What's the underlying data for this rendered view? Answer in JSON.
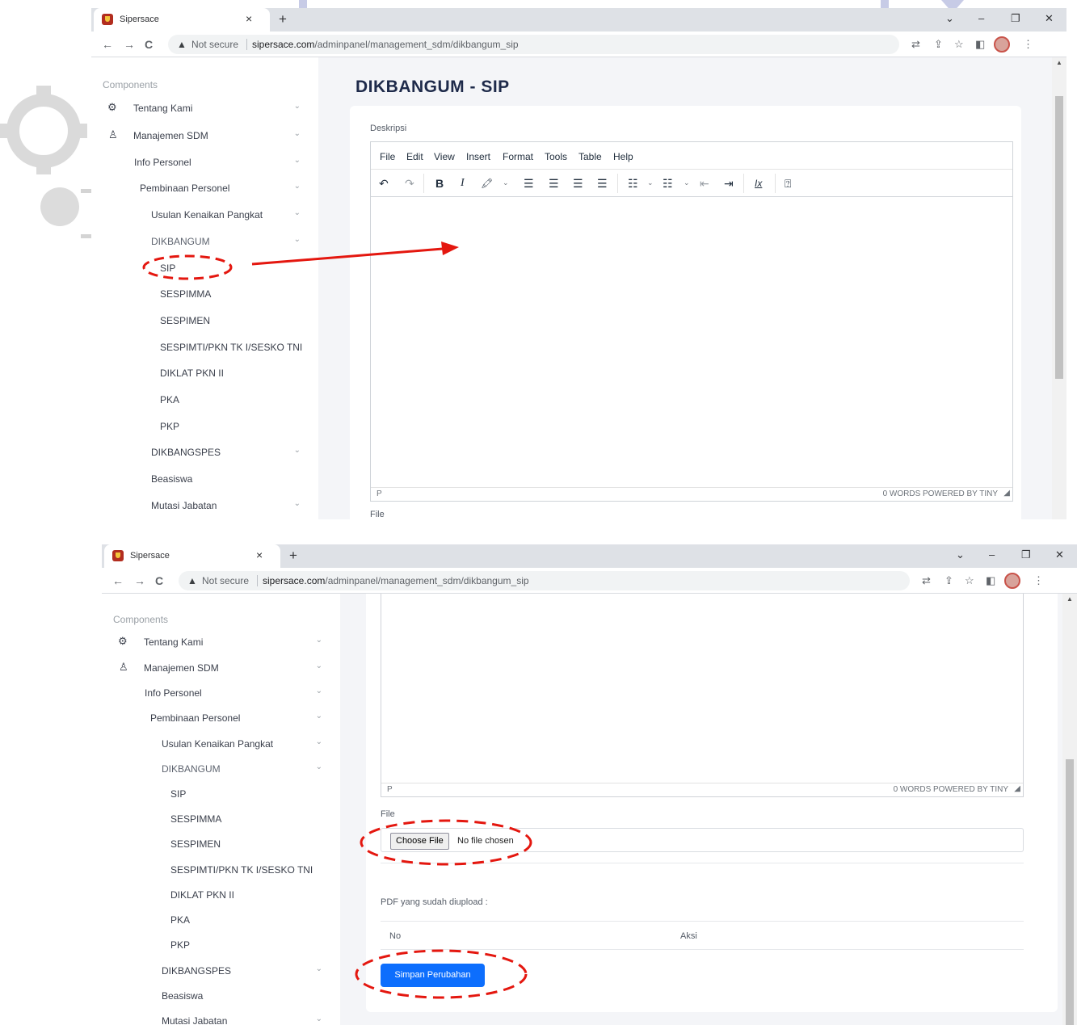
{
  "browser": {
    "tab_title": "Sipersace",
    "tab_close": "×",
    "new_tab": "+",
    "win_min": "–",
    "win_restore": "❐",
    "win_close": "✕",
    "win_menu": "⌄",
    "nav_back": "←",
    "nav_forward": "→",
    "nav_reload": "C",
    "warning_icon": "▲",
    "not_secure": "Not secure",
    "url_host": "sipersace.com",
    "url_path": "/adminpanel/management_sdm/dikbangum_sip",
    "icons": {
      "translate": "⇄",
      "share": "⇪",
      "star": "☆",
      "sidepanel": "◧",
      "menu": "⋮"
    }
  },
  "sidebar": {
    "section_label": "Components",
    "chevron": "⌄",
    "items": [
      {
        "label": "Tentang Kami",
        "icon": "gear-icon",
        "glyph": "⚙"
      },
      {
        "label": "Manajemen SDM",
        "icon": "user-icon",
        "glyph": "♙"
      },
      {
        "label": "Info Personel"
      },
      {
        "label": "Pembinaan Personel"
      },
      {
        "label": "Usulan Kenaikan Pangkat"
      },
      {
        "label": "DIKBANGUM"
      },
      {
        "label": "SIP"
      },
      {
        "label": "SESPIMMA"
      },
      {
        "label": "SESPIMEN"
      },
      {
        "label": "SESPIMTI/PKN TK I/SESKO TNI"
      },
      {
        "label": "DIKLAT PKN II"
      },
      {
        "label": "PKA"
      },
      {
        "label": "PKP"
      },
      {
        "label": "DIKBANGSPES"
      },
      {
        "label": "Beasiswa"
      },
      {
        "label": "Mutasi Jabatan"
      }
    ]
  },
  "main": {
    "page_title": "DIKBANGUM - SIP",
    "deskripsi_label": "Deskripsi",
    "file_label": "File",
    "editor": {
      "menus": [
        "File",
        "Edit",
        "View",
        "Insert",
        "Format",
        "Tools",
        "Table",
        "Help"
      ],
      "toolbar": {
        "undo": "↶",
        "redo": "↷",
        "bold": "B",
        "italic": "I",
        "highlight": "🖍",
        "align_left": "☰",
        "align_center": "☰",
        "align_right": "☰",
        "justify": "☰",
        "bullet_list": "☷",
        "numbered_list": "☷",
        "outdent": "⇤",
        "indent": "⇥",
        "clear_format": "Ix",
        "help": "⍰",
        "dropdown": "⌄"
      },
      "status_path": "P",
      "status_right": "0 WORDS  POWERED BY TINY",
      "resize": "◢"
    },
    "choose_file": "Choose File",
    "no_file": "No file chosen",
    "uploaded_label": "PDF yang sudah diupload :",
    "table_headers": [
      "No",
      "Aksi"
    ],
    "save_button": "Simpan Perubahan"
  },
  "colors": {
    "annotation": "#e4170f",
    "primary_button": "#0d6efd",
    "title": "#1e2a4a"
  }
}
